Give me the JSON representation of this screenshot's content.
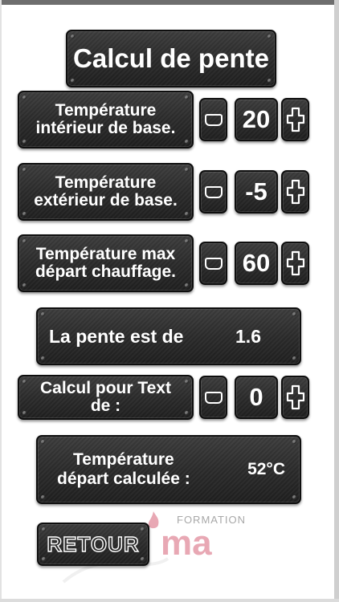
{
  "title": "Calcul de pente",
  "rows": [
    {
      "label_line1": "Température",
      "label_line2": "intérieur de base.",
      "value": "20"
    },
    {
      "label_line1": "Température",
      "label_line2": "extérieur de base.",
      "value": "-5"
    },
    {
      "label_line1": "Température max",
      "label_line2": "départ chauffage.",
      "value": "60"
    },
    {
      "label_line1": "Calcul pour Text",
      "label_line2": "de :",
      "value": "0"
    }
  ],
  "pente": {
    "label": "La pente est de",
    "value": "1.6"
  },
  "calculated": {
    "label_line1": "Température",
    "label_line2": "départ calculée :",
    "value": "52°C"
  },
  "back_button": "RETOUR",
  "logo": {
    "small": "FORMATION",
    "big": "ma"
  },
  "icons": {
    "decrement": "minus-icon",
    "increment": "plus-icon"
  },
  "colors": {
    "plate": "#2b2b2b",
    "text": "#ffffff",
    "logo": "#e8a8b4"
  }
}
